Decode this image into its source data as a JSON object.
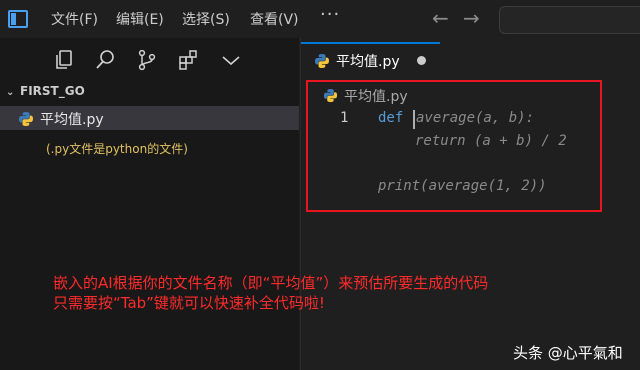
{
  "menu": {
    "file": "文件(F)",
    "edit": "编辑(E)",
    "select": "选择(S)",
    "view": "查看(V)",
    "more": "···"
  },
  "sidebar": {
    "folder_name": "FIRST_GO",
    "file_name": "平均值.py",
    "file_note": "(.py文件是python的文件)"
  },
  "editor": {
    "tab_label": "平均值.py",
    "breadcrumb": "平均值.py",
    "line_number": "1",
    "keyword": "def",
    "ghost_line_1": "average(a, b):",
    "ghost_line_2": "return (a + b) / 2",
    "ghost_line_3": "print(average(1, 2))"
  },
  "captions": {
    "line_1": "嵌入的AI根据你的文件名称（即“平均值”）来预估所要生成的代码",
    "line_2": "只需要按“Tab”键就可以快速补全代码啦!"
  },
  "watermark": "头条 @心平氣和",
  "colors": {
    "annotation_red": "#e8141e",
    "accent_blue": "#0078d4",
    "note_yellow": "#e0c060"
  },
  "icons": [
    "app-logo-icon",
    "arrow-left-icon",
    "arrow-right-icon",
    "explorer-icon",
    "search-icon",
    "source-control-icon",
    "extensions-icon",
    "chevron-down-icon",
    "python-file-icon"
  ]
}
